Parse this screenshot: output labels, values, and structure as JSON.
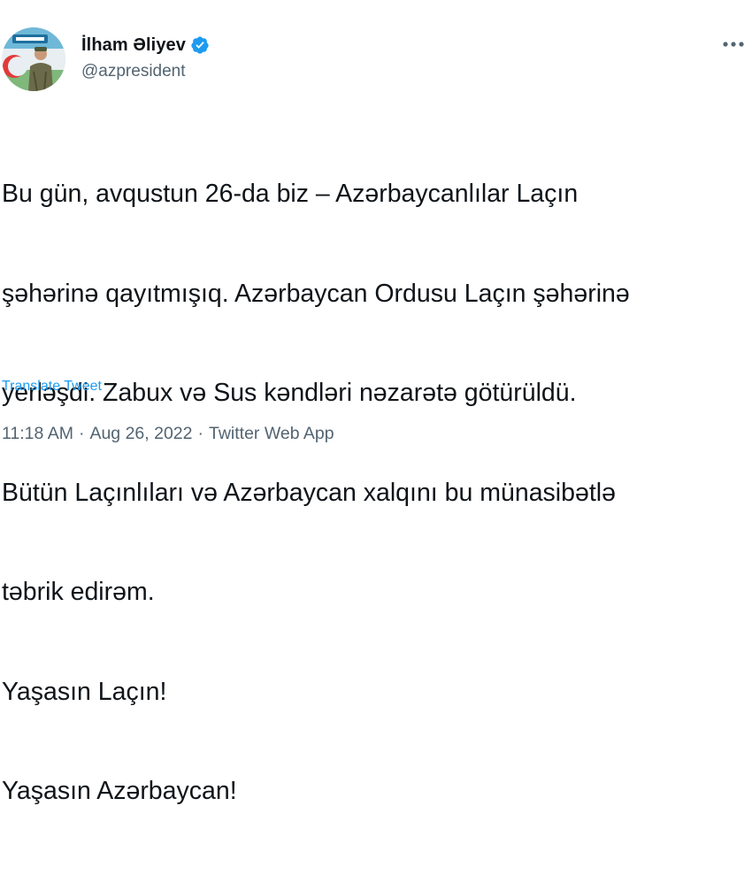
{
  "author": {
    "display_name": "İlham Əliyev",
    "handle": "@azpresident",
    "verified": true
  },
  "tweet": {
    "lines": [
      "Bu gün, avqustun 26-da biz – Azərbaycanlılar Laçın",
      "şəhərinə qayıtmışıq. Azərbaycan Ordusu Laçın şəhərinə",
      "yerləşdi. Zabux və Sus kəndləri nəzarətə götürüldü.",
      "Bütün Laçınlıları və Azərbaycan xalqını bu münasibətlə",
      "təbrik edirəm.",
      "Yaşasın Laçın!",
      "Yaşasın Azərbaycan!"
    ],
    "translate_label": "Translate Tweet"
  },
  "meta": {
    "time": "11:18 AM",
    "separator": "·",
    "date": "Aug 26, 2022",
    "source": "Twitter Web App"
  },
  "icons": {
    "verified": "verified-badge-icon",
    "more": "more-options-icon"
  },
  "colors": {
    "text": "#0f1419",
    "secondary": "#536471",
    "link": "#1d9bf0",
    "verified": "#1d9bf0"
  }
}
